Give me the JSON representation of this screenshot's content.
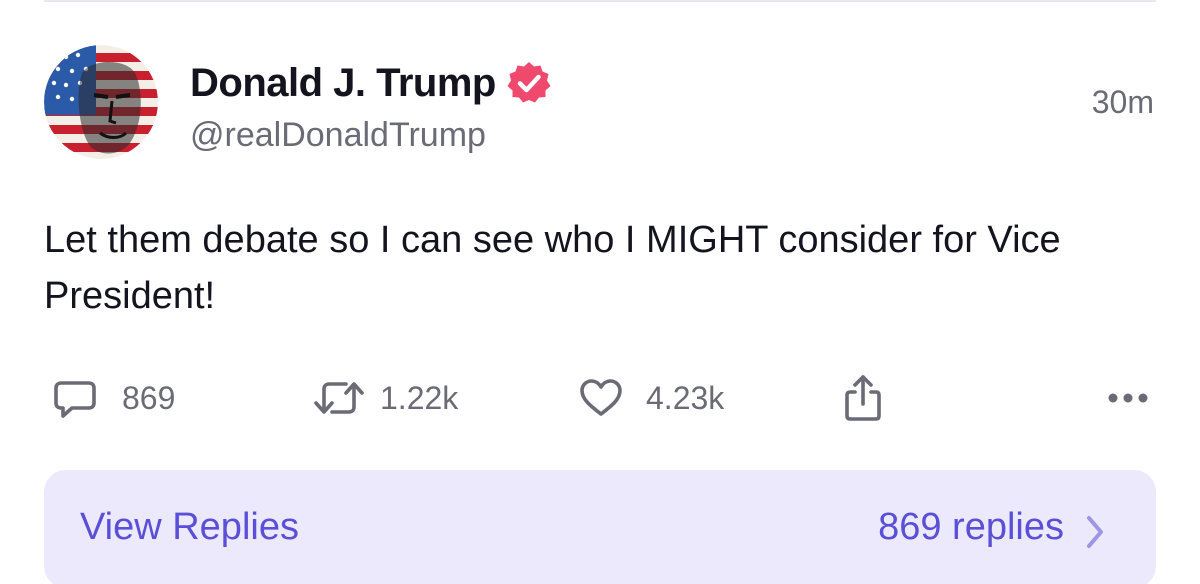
{
  "post": {
    "author": {
      "display_name": "Donald J. Trump",
      "handle": "@realDonaldTrump",
      "verified": true,
      "verified_color": "#ef4a6e"
    },
    "timestamp": "30m",
    "text": "Let them debate so I can see who I MIGHT consider for Vice President!",
    "actions": {
      "replies": {
        "icon": "comment-icon",
        "count": "869"
      },
      "retruths": {
        "icon": "retruth-icon",
        "count": "1.22k"
      },
      "likes": {
        "icon": "heart-icon",
        "count": "4.23k"
      },
      "share": {
        "icon": "share-icon"
      },
      "more": {
        "icon": "more-icon"
      }
    }
  },
  "replies_bar": {
    "label": "View Replies",
    "count": "869 replies",
    "icon": "chevron-right-icon",
    "accent": "#5a4fd6",
    "background": "#ebe9fb"
  }
}
